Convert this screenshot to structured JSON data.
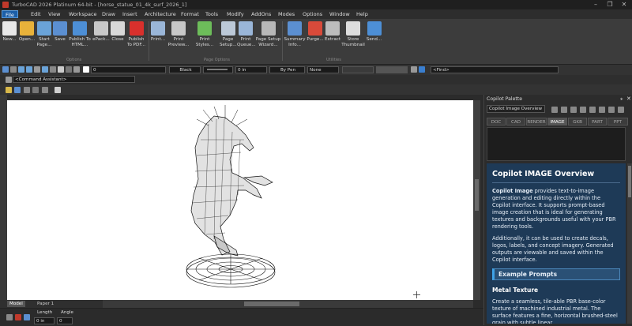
{
  "window": {
    "title": "TurboCAD 2026 Platinum 64-bit - [horse_statue_01_4k_surf_2026_1]",
    "minimize": "–",
    "restore": "❐",
    "close": "✕"
  },
  "menu": [
    "File",
    "Edit",
    "View",
    "Workspace",
    "Draw",
    "Insert",
    "Architecture",
    "Format",
    "Tools",
    "Modify",
    "AddOns",
    "Modes",
    "Options",
    "Window",
    "Help"
  ],
  "ribbon": {
    "groups": [
      "Options",
      "Page Options",
      "Utilities"
    ],
    "buttons": [
      {
        "label": "New...",
        "icon": "new-icon",
        "color": "#e8e8e8"
      },
      {
        "label": "Open...",
        "icon": "open-folder-icon",
        "color": "#e8b23a"
      },
      {
        "label": "Start Page...",
        "icon": "start-page-icon",
        "color": "#6aa3d8"
      },
      {
        "label": "Save",
        "icon": "save-icon",
        "color": "#5b8fd1"
      },
      {
        "label": "Publish To HTML...",
        "icon": "html-icon",
        "color": "#4d8fd6"
      },
      {
        "label": "ePack...",
        "icon": "epack-icon",
        "color": "#c8c8c8"
      },
      {
        "label": "Close",
        "icon": "close-doc-icon",
        "color": "#d8d8d8"
      },
      {
        "label": "Publish To PDF...",
        "icon": "pdf-icon",
        "color": "#d9302c"
      },
      {
        "label": "Print...",
        "icon": "print-icon",
        "color": "#9ab6d8"
      },
      {
        "label": "Print Preview...",
        "icon": "print-preview-icon",
        "color": "#c8c8c8"
      },
      {
        "label": "Print Styles...",
        "icon": "print-styles-icon",
        "color": "#6dbd5a"
      },
      {
        "label": "Page Setup...",
        "icon": "page-setup-icon",
        "color": "#bcc9d8"
      },
      {
        "label": "Print Queue...",
        "icon": "print-queue-icon",
        "color": "#9ab6d8"
      },
      {
        "label": "Page Setup Wizard...",
        "icon": "page-setup-wizard-icon",
        "color": "#b8b8b8"
      },
      {
        "label": "Summary Info...",
        "icon": "summary-info-icon",
        "color": "#5b8fd1"
      },
      {
        "label": "Purge...",
        "icon": "purge-icon",
        "color": "#d94a3a"
      },
      {
        "label": "Extract",
        "icon": "extract-icon",
        "color": "#bcbcbc"
      },
      {
        "label": "Store Thumbnail",
        "icon": "store-thumbnail-icon",
        "color": "#dddddd"
      },
      {
        "label": "Send...",
        "icon": "send-email-icon",
        "color": "#4d8fd6"
      }
    ]
  },
  "properties": {
    "layer": "0",
    "color": "Black",
    "width": "0 in",
    "pen": "By Pen",
    "fill": "None",
    "find_placeholder": "<Find>"
  },
  "command_assistant": "<Command Assistant>",
  "tabs": {
    "model": "Model",
    "paper": "Paper 1"
  },
  "status": {
    "length_label": "Length",
    "angle_label": "Angle",
    "length_value": "0 in",
    "angle_value": "0"
  },
  "palette": {
    "title": "Copilot Palette",
    "selector": "Copilot Image Overview",
    "tabs": [
      "DOC",
      "CAD",
      "RENDER",
      "IMAGE",
      "GKB",
      "PART",
      "PPT"
    ],
    "active_tab": "IMAGE",
    "heading": "Copilot IMAGE Overview",
    "intro_bold": "Copilot Image",
    "intro_rest": " provides text-to-image generation and editing directly within the Copilot interface. It supports prompt-based image creation that is ideal for generating textures and backgrounds useful with your PBR rendering tools.",
    "para2": "Additionally, it can be used to create decals, logos, labels, and concept imagery. Generated outputs are viewable and saved within the Copilot interface.",
    "callout": "Example Prompts",
    "subheading": "Metal Texture",
    "para3": "Create a seamless, tile-able PBR base-color texture of machined industrial metal. The surface features a fine, horizontal brushed-steel grain with subtle linear"
  },
  "colors": {
    "accent": "#1c5fa8",
    "doc_bg": "#1e3a57",
    "callout_border": "#3fa2e6"
  }
}
